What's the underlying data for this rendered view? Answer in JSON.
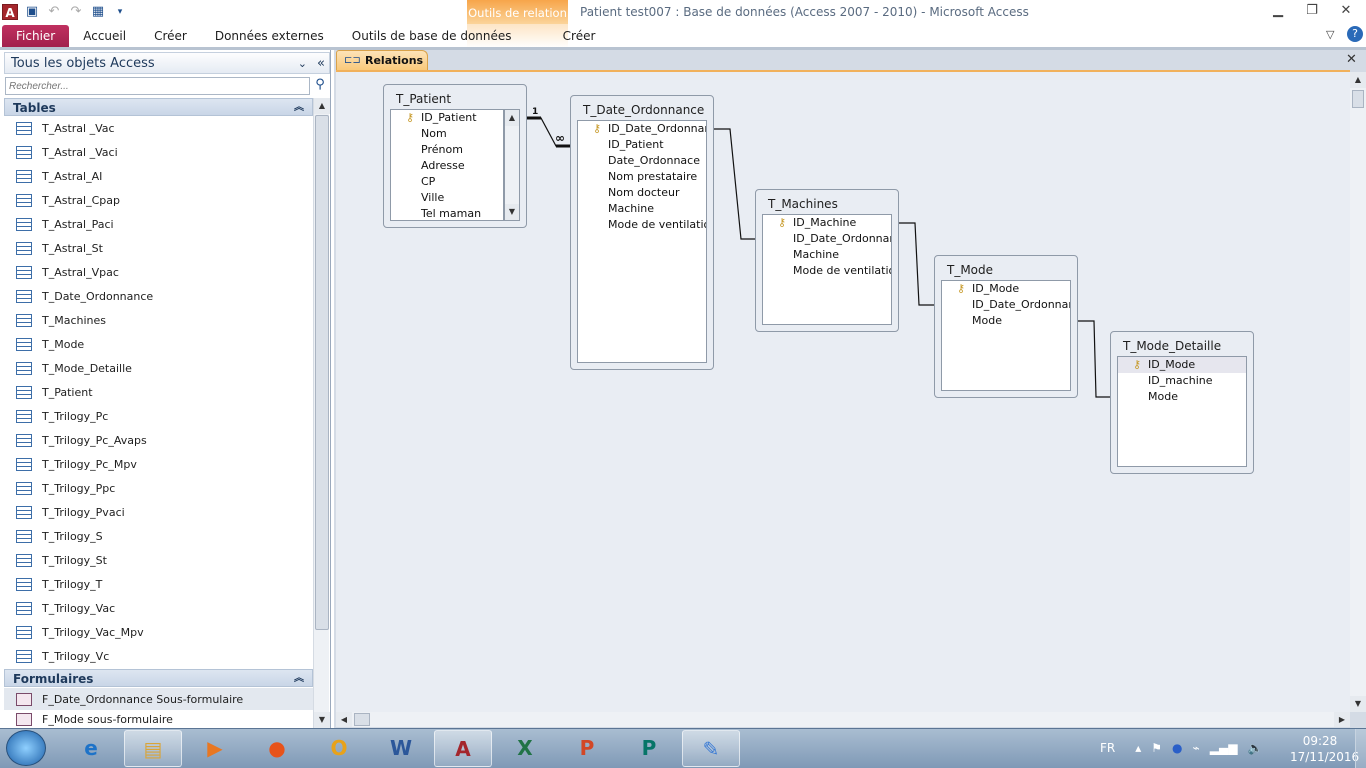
{
  "window": {
    "title": "Patient test007 : Base de données (Access 2007 - 2010)  -  Microsoft Access",
    "app_icon": "A",
    "context_tab_group": "Outils de relation",
    "context_tab": "Créer"
  },
  "ribbon": {
    "tabs": [
      "Fichier",
      "Accueil",
      "Créer",
      "Données externes",
      "Outils de base de données"
    ]
  },
  "nav": {
    "title": "Tous les objets Access",
    "search_placeholder": "Rechercher...",
    "groups": [
      {
        "label": "Tables",
        "items": [
          "T_Astral _Vac",
          "T_Astral _Vaci",
          "T_Astral_AI",
          "T_Astral_Cpap",
          "T_Astral_Paci",
          "T_Astral_St",
          "T_Astral_Vpac",
          "T_Date_Ordonnance",
          "T_Machines",
          "T_Mode",
          "T_Mode_Detaille",
          "T_Patient",
          "T_Trilogy_Pc",
          "T_Trilogy_Pc_Avaps",
          "T_Trilogy_Pc_Mpv",
          "T_Trilogy_Ppc",
          "T_Trilogy_Pvaci",
          "T_Trilogy_S",
          "T_Trilogy_St",
          "T_Trilogy_T",
          "T_Trilogy_Vac",
          "T_Trilogy_Vac_Mpv",
          "T_Trilogy_Vc"
        ]
      },
      {
        "label": "Formulaires",
        "items": [
          "F_Date_Ordonnance Sous-formulaire",
          "F_Mode sous-formulaire"
        ]
      }
    ]
  },
  "document": {
    "tab_label": "Relations"
  },
  "tables": [
    {
      "name": "T_Patient",
      "fields": [
        "ID_Patient",
        "Nom",
        "Prénom",
        "Adresse",
        "CP",
        "Ville",
        "Tel maman"
      ],
      "key": 0
    },
    {
      "name": "T_Date_Ordonnance",
      "fields": [
        "ID_Date_Ordonnance",
        "ID_Patient",
        "Date_Ordonnace",
        "Nom prestataire",
        "Nom docteur",
        "Machine",
        "Mode de ventilation"
      ],
      "key": 0
    },
    {
      "name": "T_Machines",
      "fields": [
        "ID_Machine",
        "ID_Date_Ordonnance",
        "Machine",
        "Mode de ventilation"
      ],
      "key": 0
    },
    {
      "name": "T_Mode",
      "fields": [
        "ID_Mode",
        "ID_Date_Ordonnance",
        "Mode"
      ],
      "key": 0
    },
    {
      "name": "T_Mode_Detaille",
      "fields": [
        "ID_Mode",
        "ID_machine",
        "Mode"
      ],
      "key": 0
    }
  ],
  "relationships": [
    {
      "from": "T_Patient.ID_Patient",
      "to": "T_Date_Ordonnance.ID_Patient",
      "one_label": "1",
      "many_label": "∞"
    },
    {
      "from": "T_Date_Ordonnance.ID_Date_Ordonnance",
      "to": "T_Machines.ID_Date_Ordonnance"
    },
    {
      "from": "T_Machines.ID_Machine",
      "to": "T_Mode.ID_Mode"
    },
    {
      "from": "T_Mode.ID_Date_Ordonnance",
      "to": "T_Mode_Detaille.ID_Mode"
    }
  ],
  "taskbar": {
    "apps": [
      "internet-explorer",
      "explorer",
      "media-player",
      "firefox",
      "outlook",
      "word",
      "access",
      "excel",
      "powerpoint",
      "publisher",
      "paint"
    ],
    "language": "FR",
    "time": "09:28",
    "date": "17/11/2016"
  }
}
